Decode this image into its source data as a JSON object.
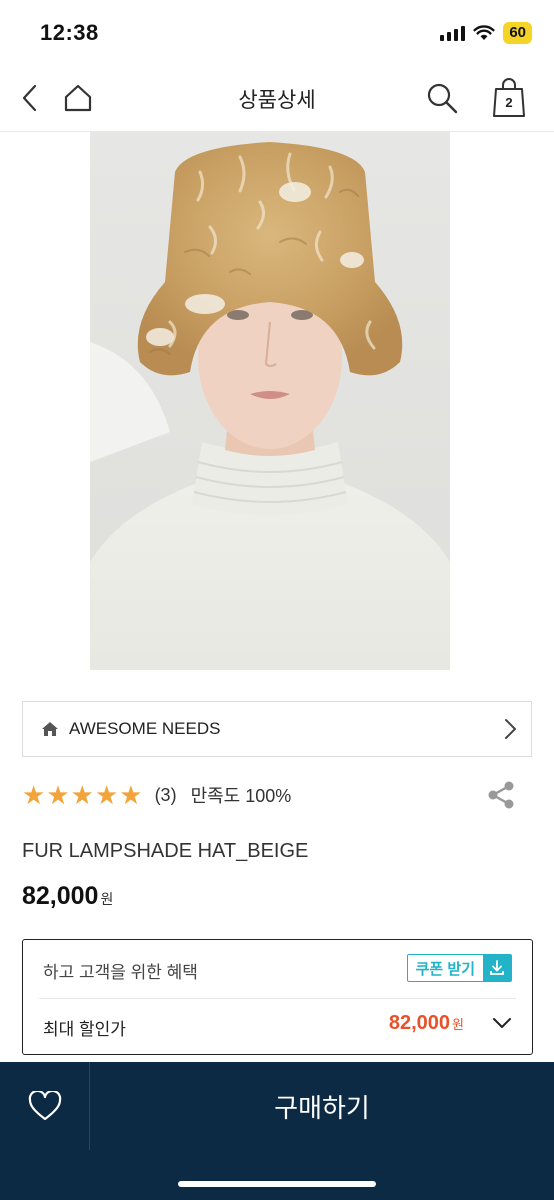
{
  "status_bar": {
    "time": "12:38",
    "battery": "60",
    "icons": [
      "signal-icon",
      "wifi-icon",
      "battery-icon"
    ]
  },
  "header": {
    "title": "상품상세",
    "cart_count": "2",
    "icons": [
      "back-icon",
      "home-icon",
      "search-icon",
      "cart-icon"
    ]
  },
  "product": {
    "image_alt_icon": "product-photo",
    "brand": "AWESOME NEEDS",
    "rating_stars": 5,
    "review_count": "(3)",
    "satisfaction": "만족도 100%",
    "name": "FUR LAMPSHADE HAT_BEIGE",
    "price": "82,000",
    "currency": "원"
  },
  "coupon": {
    "label": "하고 고객을 위한 혜택",
    "button_label": "쿠폰 받기",
    "max_discount_label": "최대 할인가",
    "max_discount_price": "82,000",
    "currency": "원"
  },
  "bottom_bar": {
    "buy_label": "구매하기"
  },
  "colors": {
    "accent": "#23b3c8",
    "discount": "#e8522b",
    "star": "#f2a33a",
    "bottom_bar": "#0c2a44"
  }
}
